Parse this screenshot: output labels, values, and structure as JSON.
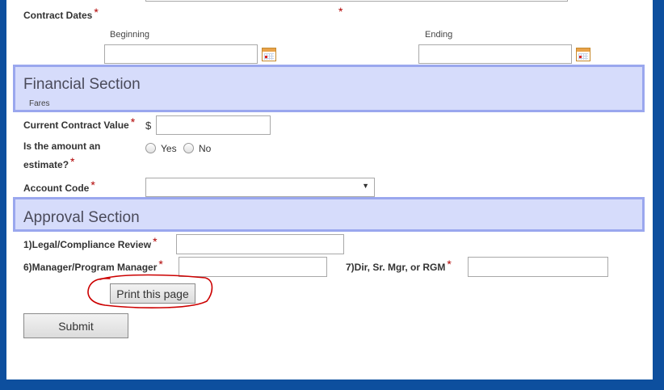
{
  "contract": {
    "dates_label": "Contract Dates",
    "required_mark": "*",
    "beginning_label": "Beginning",
    "ending_label": "Ending",
    "beginning_value": "",
    "ending_value": ""
  },
  "financial": {
    "title": "Financial Section",
    "subtitle": "Fares",
    "current_value_label": "Current Contract Value",
    "currency_symbol": "$",
    "current_value": "",
    "estimate_label_line1": "Is the amount an",
    "estimate_label_line2": "estimate?",
    "yes_label": "Yes",
    "no_label": "No",
    "account_code_label": "Account Code",
    "account_code_value": "",
    "select_arrow": "▼"
  },
  "approval": {
    "title": "Approval Section",
    "legal_label": "1)Legal/Compliance Review",
    "manager_label": "6)Manager/Program Manager",
    "dir_label": "7)Dir, Sr. Mgr, or RGM",
    "legal_value": "",
    "manager_value": "",
    "dir_value": "",
    "print_button": "Print this page"
  },
  "submit_button": "Submit",
  "icons": {
    "calendar": "calendar-icon"
  },
  "colors": {
    "page_background": "#0d4f9e",
    "section_fill": "#d6dcfb",
    "section_border": "#9aa7ee",
    "required": "#b00000",
    "annotation": "#cc0000"
  }
}
